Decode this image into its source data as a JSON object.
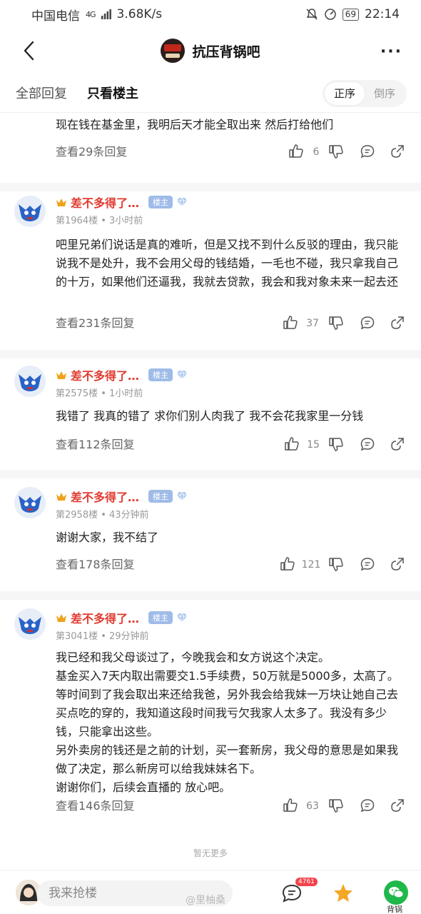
{
  "status": {
    "carrier": "中国电信",
    "signal": "4G",
    "speed": "3.68K/s",
    "battery": "69",
    "time": "22:14"
  },
  "nav": {
    "title": "抗压背锅吧"
  },
  "tabs": {
    "all": "全部回复",
    "op_only": "只看楼主",
    "sort_asc": "正序",
    "sort_desc": "倒序"
  },
  "posts": [
    {
      "content": "现在钱在基金里，我明后天才能全取出来 然后打给他们",
      "view_replies": "查看29条回复",
      "likes": "6"
    },
    {
      "user": "差不多得了…",
      "badge": "楼主",
      "floor_time": "第1964楼 • 3小时前",
      "content": "吧里兄弟们说话是真的难听，但是又找不到什么反驳的理由，我只能说我不是处升，我不会用父母的钱结婚，一毛也不碰，我只拿我自己的十万，如果他们还逼我，我就去贷款，我会和我对象未来一起去还",
      "view_replies": "查看231条回复",
      "likes": "37"
    },
    {
      "user": "差不多得了…",
      "badge": "楼主",
      "floor_time": "第2575楼 • 1小时前",
      "content": "我错了 我真的错了 求你们别人肉我了 我不会花我家里一分钱",
      "view_replies": "查看112条回复",
      "likes": "15"
    },
    {
      "user": "差不多得了…",
      "badge": "楼主",
      "floor_time": "第2958楼 • 43分钟前",
      "content": "谢谢大家，我不结了",
      "view_replies": "查看178条回复",
      "likes": "121"
    },
    {
      "user": "差不多得了…",
      "badge": "楼主",
      "floor_time": "第3041楼 • 29分钟前",
      "content_lines": [
        "我已经和我父母谈过了，今晚我会和女方说这个决定。",
        "基金买入7天内取出需要交1.5手续费，50万就是5000多，太高了。等时间到了我会取出来还给我爸，另外我会给我妹一万块让她自己去买点吃的穿的，我知道这段时间我亏欠我家人太多了。我没有多少钱，只能拿出这些。",
        "另外卖房的钱还是之前的计划，买一套新房，我父母的意思是如果我做了决定，那么新房可以给我妹妹名下。",
        "谢谢你们，后续会直播的 放心吧。"
      ],
      "view_replies": "查看146条回复",
      "likes": "63"
    }
  ],
  "footer": {
    "no_more": "暂无更多",
    "reply_placeholder": "我来抢楼",
    "comment_badge": "4761",
    "wechat_label": "背锅",
    "watermark": "@里柚桑"
  },
  "colors": {
    "username": "#e03a2f",
    "op_badge": "#9fbce8",
    "badge_red": "#f2424a",
    "wechat": "#1fb84a"
  },
  "icons": [
    "back-icon",
    "more-icon",
    "crown-icon",
    "diamond-icon",
    "thumb-up-icon",
    "thumb-down-icon",
    "comment-icon",
    "share-icon",
    "star-icon",
    "wechat-icon"
  ]
}
